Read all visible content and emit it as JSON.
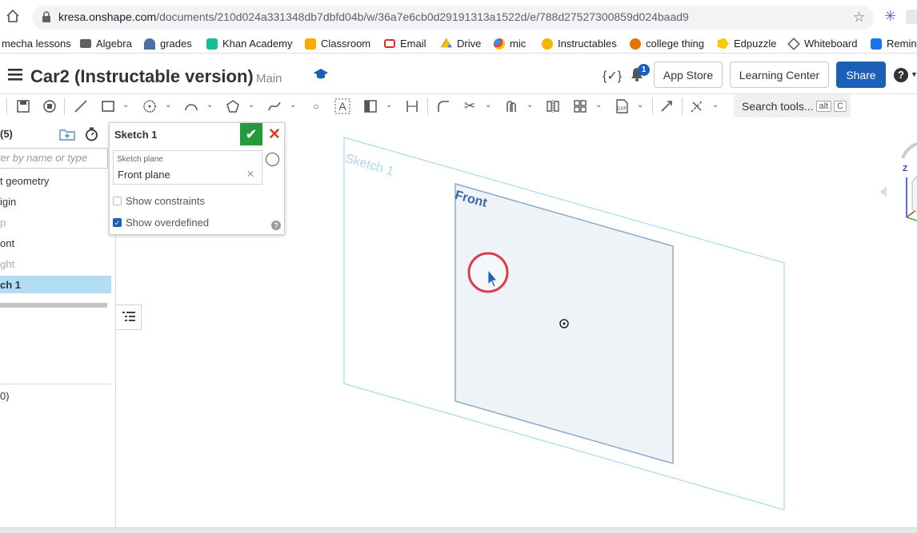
{
  "browser": {
    "url_host": "kresa.onshape.com",
    "url_path": "/documents/210d024a331348db7dbfd04b/w/36a7e6cb0d29191313a1522d/e/788d27527300859d024baad9"
  },
  "bookmarks": [
    {
      "label": "mecha lessons",
      "color": "#ffffff"
    },
    {
      "label": "Algebra",
      "color": "#5f6368"
    },
    {
      "label": "grades",
      "color": "#4a6fa5"
    },
    {
      "label": "Khan Academy",
      "color": "#14bf96"
    },
    {
      "label": "Classroom",
      "color": "#f9ab00"
    },
    {
      "label": "Email",
      "color": "#d93025"
    },
    {
      "label": "Drive",
      "color": "#1e8e3e"
    },
    {
      "label": "mic",
      "color": "#4285f4"
    },
    {
      "label": "Instructables",
      "color": "#f4b400"
    },
    {
      "label": "college thing",
      "color": "#e37400"
    },
    {
      "label": "Edpuzzle",
      "color": "#f9c900"
    },
    {
      "label": "Whiteboard",
      "color": "#5f6368"
    },
    {
      "label": "Remin",
      "color": "#1a73e8"
    }
  ],
  "header": {
    "title": "Car2 (Instructable version)",
    "branch": "Main",
    "notification_count": "1",
    "app_store": "App Store",
    "learning_center": "Learning Center",
    "share": "Share"
  },
  "toolbar": {
    "search_label": "Search tools...",
    "shortcut_alt": "alt",
    "shortcut_key": "C"
  },
  "left_panel": {
    "count": "(5)",
    "filter_placeholder": "ter by name or type",
    "items": [
      {
        "label": "t geometry",
        "state": "normal"
      },
      {
        "label": "igin",
        "state": "normal"
      },
      {
        "label": "p",
        "state": "dim"
      },
      {
        "label": "ont",
        "state": "normal"
      },
      {
        "label": "ght",
        "state": "dim"
      },
      {
        "label": "ch 1",
        "state": "selected"
      }
    ],
    "parts_count": "0)"
  },
  "sketch_dialog": {
    "title": "Sketch 1",
    "plane_label": "Sketch plane",
    "plane_value": "Front plane",
    "show_constraints": "Show constraints",
    "show_constraints_checked": false,
    "show_overdefined": "Show overdefined",
    "show_overdefined_checked": true
  },
  "viewport": {
    "sketch_label": "Sketch 1",
    "plane_label": "Front",
    "triad_z": "Z",
    "colors": {
      "sketch_outline": "#a9d8f0",
      "plane_fill": "#eef3f8",
      "plane_stroke": "#8fa8c8",
      "plane_text": "#3a66a8",
      "cursor_ring": "#e0394a"
    }
  }
}
